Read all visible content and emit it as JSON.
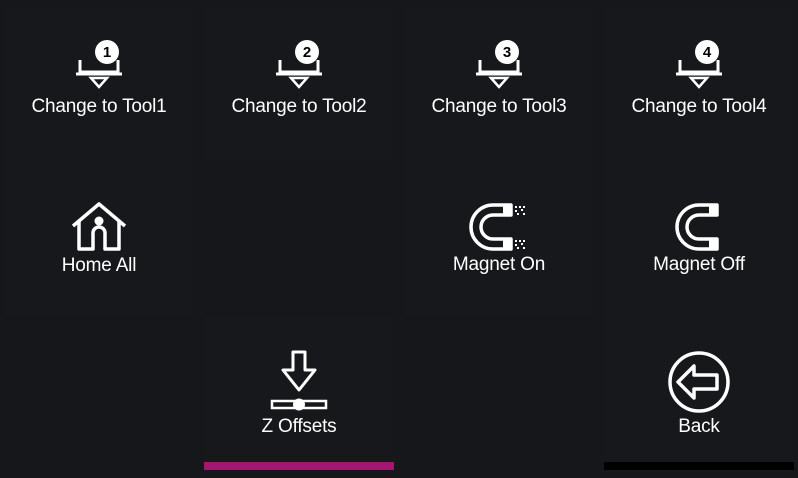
{
  "tools": [
    {
      "number": "1",
      "label": "Change to Tool1"
    },
    {
      "number": "2",
      "label": "Change to Tool2"
    },
    {
      "number": "3",
      "label": "Change to Tool3"
    },
    {
      "number": "4",
      "label": "Change to Tool4"
    }
  ],
  "home_all": {
    "label": "Home All",
    "icon": "home-icon"
  },
  "magnet_on": {
    "label": "Magnet On",
    "icon": "magnet-on-icon"
  },
  "magnet_off": {
    "label": "Magnet Off",
    "icon": "magnet-off-icon"
  },
  "z_offsets": {
    "label": "Z Offsets",
    "icon": "z-offset-icon"
  },
  "back": {
    "label": "Back",
    "icon": "back-arrow-icon"
  },
  "colors": {
    "background": "#15171a",
    "active_underline": "#a4176f",
    "back_underline": "#000000",
    "text": "#ffffff"
  }
}
